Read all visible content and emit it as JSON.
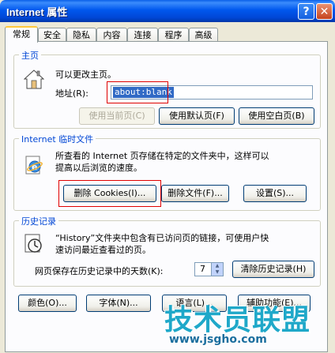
{
  "window": {
    "title": "Internet 属性",
    "help_label": "?",
    "close_label": "✕"
  },
  "tabs": [
    "常规",
    "安全",
    "隐私",
    "内容",
    "连接",
    "程序",
    "高级"
  ],
  "homepage": {
    "group_title": "主页",
    "description": "可以更改主页。",
    "address_label": "地址(R):",
    "address_value": "about:blank",
    "btn_current": "使用当前页(C)",
    "btn_default": "使用默认页(F)",
    "btn_blank": "使用空白页(B)"
  },
  "temp_files": {
    "group_title": "Internet 临时文件",
    "description_line1": "所查看的 Internet 页存储在特定的文件夹中，这样可以",
    "description_line2": "提高以后浏览的速度。",
    "btn_delete_cookies": "删除 Cookies(I)...",
    "btn_delete_files": "删除文件(F)...",
    "btn_settings": "设置(S)..."
  },
  "history": {
    "group_title": "历史记录",
    "description_line1": "“History”文件夹中包含有已访问页的链接，可使用户快",
    "description_line2": "速访问最近查看过的页。",
    "days_label": "网页保存在历史记录中的天数(K):",
    "days_value": "7",
    "btn_clear": "清除历史记录(H)"
  },
  "bottom_buttons": [
    "颜色(O)...",
    "字体(N)...",
    "语言(L)...",
    "辅助功能(E)..."
  ],
  "watermark": {
    "name": "技术员联盟",
    "url": "www.jsgho.com"
  }
}
